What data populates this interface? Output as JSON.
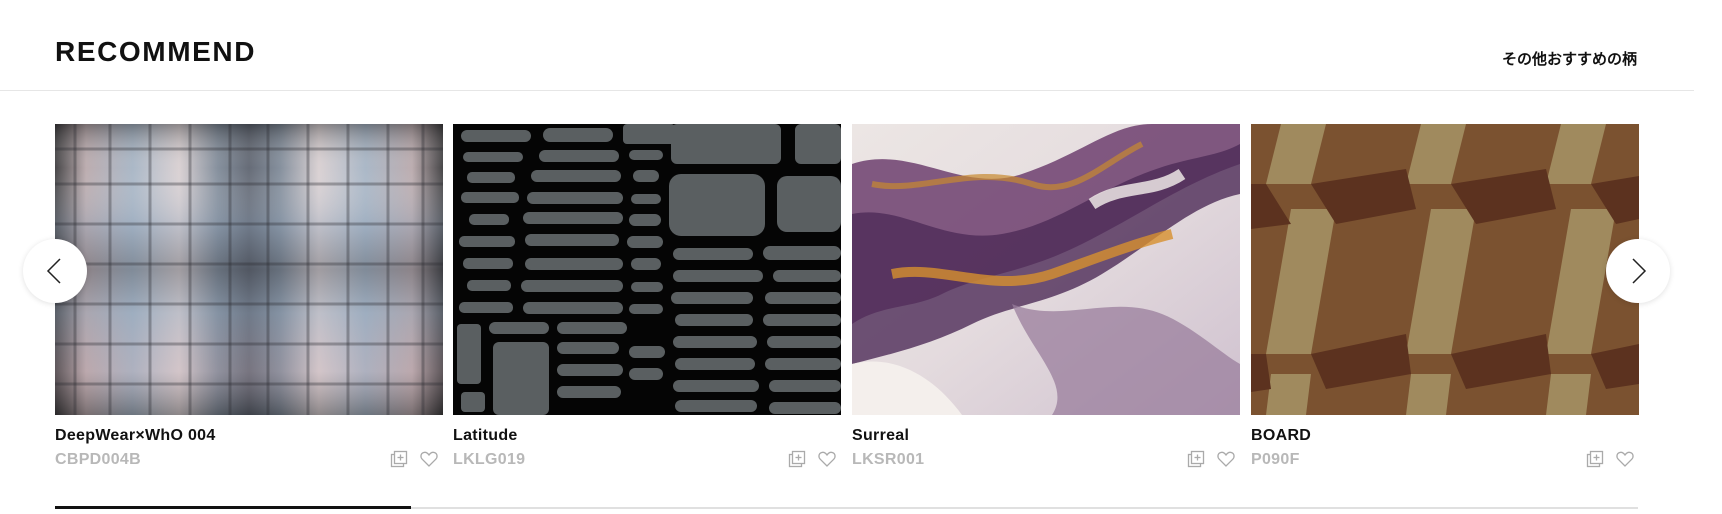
{
  "section": {
    "title": "RECOMMEND",
    "more_link": "その他おすすめの柄"
  },
  "items": [
    {
      "name": "DeepWear×WhO  004",
      "code": "CBPD004B"
    },
    {
      "name": "Latitude",
      "code": "LKLG019"
    },
    {
      "name": "Surreal",
      "code": "LKSR001"
    },
    {
      "name": "BOARD",
      "code": "P090F"
    }
  ],
  "icons": {
    "prev": "chevron-left-icon",
    "next": "chevron-right-icon",
    "sample": "add-sample-icon",
    "favorite": "heart-icon"
  },
  "carousel": {
    "progress_fraction": 0.225
  },
  "colors": {
    "text": "#111111",
    "code": "#b8b8b8",
    "track": "#e0e0e0",
    "indicator": "#111111"
  }
}
